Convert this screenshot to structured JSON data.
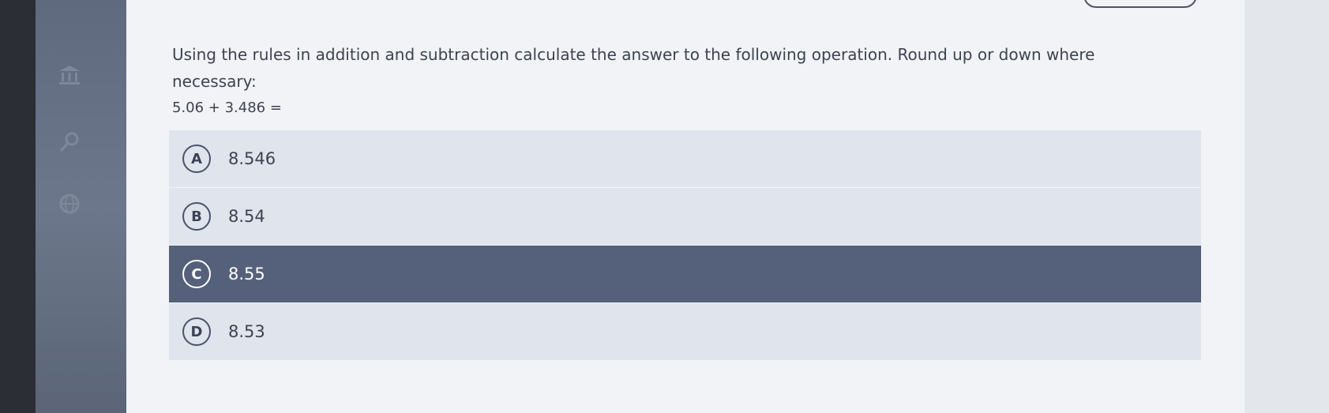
{
  "question": {
    "text": "Using the rules in addition and subtraction calculate the answer to the following operation. Round up or down where necessary:",
    "equation": "5.06 + 3.486 ="
  },
  "options": [
    {
      "letter": "A",
      "value": "8.546",
      "selected": false
    },
    {
      "letter": "B",
      "value": "8.54",
      "selected": false
    },
    {
      "letter": "C",
      "value": "8.55",
      "selected": true
    },
    {
      "letter": "D",
      "value": "8.53",
      "selected": false
    }
  ],
  "colors": {
    "selected_background": "#55607a",
    "option_background": "#dfe4ed",
    "text": "#3d4350"
  },
  "sidebar": {
    "icons": [
      "bank-icon",
      "search-icon",
      "globe-icon"
    ]
  }
}
